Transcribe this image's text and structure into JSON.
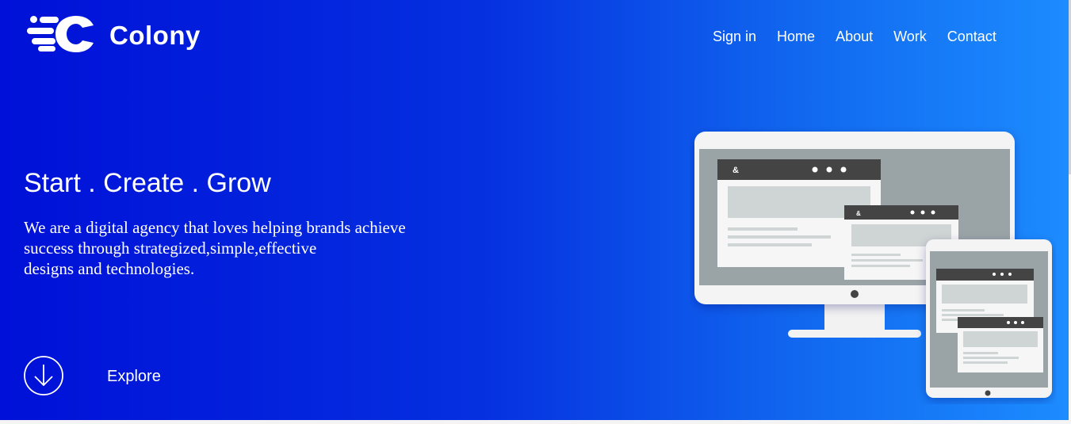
{
  "brand": {
    "name": "Colony",
    "logo_icon": "colony-c-logo-icon"
  },
  "nav": {
    "items": [
      "Sign in",
      "Home",
      "About",
      "Work",
      "Contact"
    ]
  },
  "hero": {
    "headline": "Start . Create . Grow",
    "tagline_lines": [
      "We are a digital agency that loves helping brands achieve",
      "success through strategized,simple,effective",
      "designs and technologies."
    ],
    "explore_label": "Explore",
    "explore_icon": "arrow-down-circle-icon",
    "illustration_icon": "devices-illustration-icon",
    "window_glyph": "&"
  },
  "colors": {
    "gradient_start": "#0010d8",
    "gradient_end": "#1c8cff",
    "text": "#ffffff"
  }
}
